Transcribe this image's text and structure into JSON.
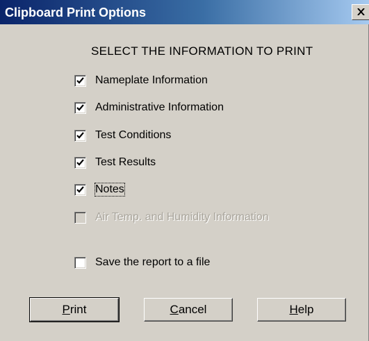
{
  "dialog": {
    "title": "Clipboard Print Options",
    "close_glyph": "✕",
    "heading": "SELECT THE INFORMATION TO PRINT"
  },
  "options": [
    {
      "label": "Nameplate Information",
      "checked": true,
      "enabled": true
    },
    {
      "label": "Administrative Information",
      "checked": true,
      "enabled": true
    },
    {
      "label": "Test Conditions",
      "checked": true,
      "enabled": true
    },
    {
      "label": "Test Results",
      "checked": true,
      "enabled": true
    },
    {
      "label": "Notes",
      "checked": true,
      "enabled": true,
      "focused": true
    },
    {
      "label": "Air Temp. and Humidity Information",
      "checked": false,
      "enabled": false
    }
  ],
  "save_option": {
    "label": "Save the report to a file",
    "checked": false,
    "enabled": true
  },
  "buttons": {
    "print": {
      "accel": "P",
      "rest": "rint"
    },
    "cancel": {
      "accel": "C",
      "rest": "ancel"
    },
    "help": {
      "accel": "H",
      "rest": "elp"
    }
  },
  "colors": {
    "face": "#d4d0c8",
    "title_start": "#0a246a",
    "title_end": "#a6caf0",
    "disabled_text": "#a9a59c"
  },
  "icons": {
    "checkmark": "check-icon",
    "close": "close-icon"
  }
}
